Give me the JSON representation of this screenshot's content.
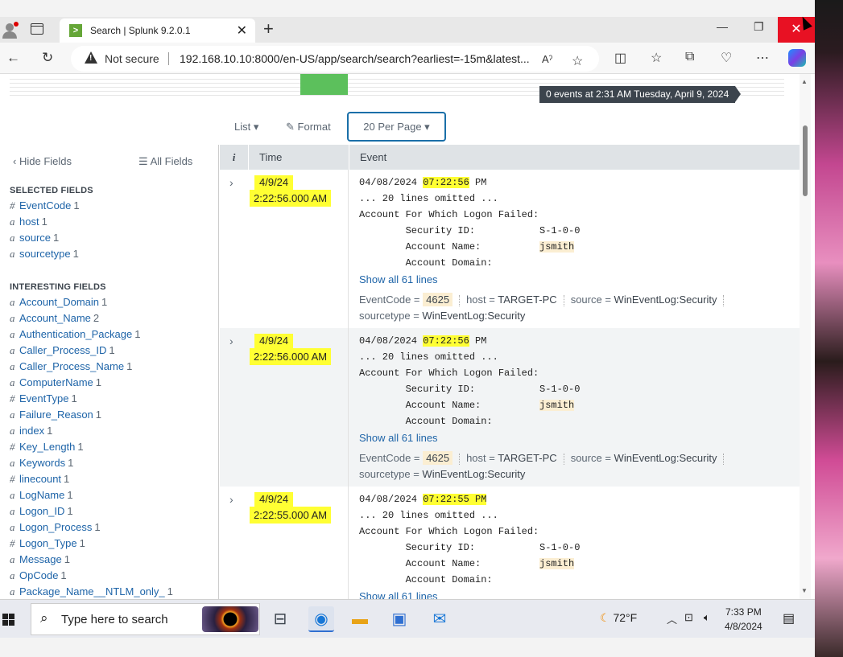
{
  "browser": {
    "tab_title": "Search | Splunk 9.2.0.1",
    "tab_close": "✕",
    "new_tab": "+",
    "security_label": "Not secure",
    "url": "192.168.10.10:8000/en-US/app/search/search?earliest=-15m&latest..."
  },
  "timeline": {
    "tooltip": "0 events at 2:31 AM Tuesday, April 9, 2024"
  },
  "toolbar": {
    "list": "List ▾",
    "format": "Format",
    "per_page": "20 Per Page ▾"
  },
  "fields_sidebar": {
    "hide_fields": "Hide Fields",
    "all_fields": "All Fields",
    "selected_title": "SELECTED FIELDS",
    "selected": [
      {
        "type": "#",
        "name": "EventCode",
        "count": "1"
      },
      {
        "type": "a",
        "name": "host",
        "count": "1"
      },
      {
        "type": "a",
        "name": "source",
        "count": "1"
      },
      {
        "type": "a",
        "name": "sourcetype",
        "count": "1"
      }
    ],
    "interesting_title": "INTERESTING FIELDS",
    "interesting": [
      {
        "type": "a",
        "name": "Account_Domain",
        "count": "1"
      },
      {
        "type": "a",
        "name": "Account_Name",
        "count": "2"
      },
      {
        "type": "a",
        "name": "Authentication_Package",
        "count": "1"
      },
      {
        "type": "a",
        "name": "Caller_Process_ID",
        "count": "1"
      },
      {
        "type": "a",
        "name": "Caller_Process_Name",
        "count": "1"
      },
      {
        "type": "a",
        "name": "ComputerName",
        "count": "1"
      },
      {
        "type": "#",
        "name": "EventType",
        "count": "1"
      },
      {
        "type": "a",
        "name": "Failure_Reason",
        "count": "1"
      },
      {
        "type": "a",
        "name": "index",
        "count": "1"
      },
      {
        "type": "#",
        "name": "Key_Length",
        "count": "1"
      },
      {
        "type": "a",
        "name": "Keywords",
        "count": "1"
      },
      {
        "type": "#",
        "name": "linecount",
        "count": "1"
      },
      {
        "type": "a",
        "name": "LogName",
        "count": "1"
      },
      {
        "type": "a",
        "name": "Logon_ID",
        "count": "1"
      },
      {
        "type": "a",
        "name": "Logon_Process",
        "count": "1"
      },
      {
        "type": "#",
        "name": "Logon_Type",
        "count": "1"
      },
      {
        "type": "a",
        "name": "Message",
        "count": "1"
      },
      {
        "type": "a",
        "name": "OpCode",
        "count": "1"
      },
      {
        "type": "a",
        "name": "Package_Name__NTLM_only_",
        "count": "1"
      }
    ]
  },
  "table": {
    "col_info": "i",
    "col_time": "Time",
    "col_event": "Event"
  },
  "events": [
    {
      "date": "4/9/24",
      "time": "2:22:56.000 AM",
      "ts_date": "04/08/2024 ",
      "ts_time": "07:22:56",
      "ts_ampm": " PM",
      "omitted": "... 20 lines omitted ...",
      "heading": "Account For Which Logon Failed:",
      "sid_label": "        Security ID:",
      "sid_value": "S-1-0-0",
      "name_label": "        Account Name:",
      "name_value": "jsmith",
      "domain_label": "        Account Domain:",
      "show_all": "Show all 61 lines",
      "eventcode": "4625",
      "host": "TARGET-PC",
      "source": "WinEventLog:Security",
      "sourcetype": "WinEventLog:Security"
    },
    {
      "date": "4/9/24",
      "time": "2:22:56.000 AM",
      "ts_date": "04/08/2024 ",
      "ts_time": "07:22:56",
      "ts_ampm": " PM",
      "omitted": "... 20 lines omitted ...",
      "heading": "Account For Which Logon Failed:",
      "sid_label": "        Security ID:",
      "sid_value": "S-1-0-0",
      "name_label": "        Account Name:",
      "name_value": "jsmith",
      "domain_label": "        Account Domain:",
      "show_all": "Show all 61 lines",
      "eventcode": "4625",
      "host": "TARGET-PC",
      "source": "WinEventLog:Security",
      "sourcetype": "WinEventLog:Security"
    },
    {
      "date": "4/9/24",
      "time": "2:22:55.000 AM",
      "ts_date": "04/08/2024 ",
      "ts_time": "07:22:55 PM",
      "ts_ampm": "",
      "omitted": "... 20 lines omitted ...",
      "heading": "Account For Which Logon Failed:",
      "sid_label": "        Security ID:",
      "sid_value": "S-1-0-0",
      "name_label": "        Account Name:",
      "name_value": "jsmith",
      "domain_label": "        Account Domain:",
      "show_all": "Show all 61 lines"
    }
  ],
  "kv_labels": {
    "eventcode": "EventCode =",
    "host": "host =",
    "source": "source =",
    "sourcetype": "sourcetype ="
  },
  "taskbar": {
    "search_placeholder": "Type here to search",
    "weather": "72°F",
    "time": "7:33 PM",
    "date": "4/8/2024"
  },
  "colors": {
    "splunk_green": "#65a637",
    "highlight": "#ffff33",
    "link": "#1e64a8",
    "accent_blue": "#1a6fa8"
  }
}
